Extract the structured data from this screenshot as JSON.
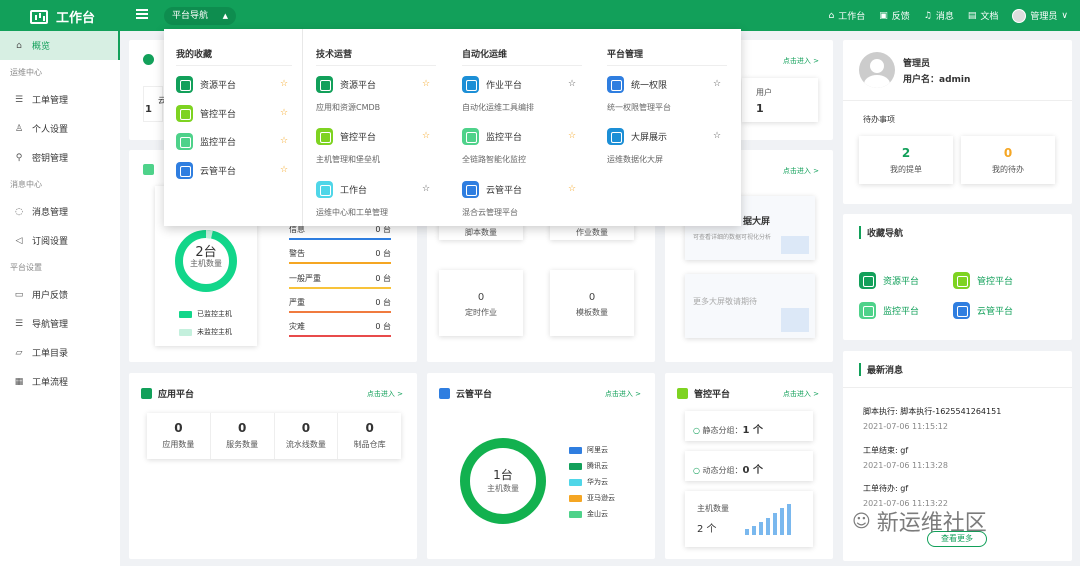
{
  "header": {
    "app_title": "工作台",
    "nav_pill": "平台导航",
    "links": [
      "工作台",
      "反馈",
      "消息",
      "文档"
    ],
    "user": "管理员"
  },
  "sidebar": {
    "overview": "概览",
    "group1": "运维中心",
    "group1_items": [
      "工单管理",
      "个人设置",
      "密钥管理"
    ],
    "group2": "消息中心",
    "group2_items": [
      "消息管理",
      "订阅设置"
    ],
    "group3": "平台设置",
    "group3_items": [
      "用户反馈",
      "导航管理",
      "工单目录",
      "工单流程"
    ]
  },
  "dropdown": {
    "col1": {
      "title": "我的收藏",
      "items": [
        "资源平台",
        "管控平台",
        "监控平台",
        "云管平台"
      ]
    },
    "col2": {
      "title": "技术运营",
      "items": [
        {
          "name": "资源平台",
          "desc": "应用和资源CMDB"
        },
        {
          "name": "管控平台",
          "desc": "主机管理和堡垒机"
        },
        {
          "name": "工作台",
          "desc": "运维中心和工单管理"
        }
      ]
    },
    "col3": {
      "title": "自动化运维",
      "items": [
        {
          "name": "作业平台",
          "desc": "自动化运维工具编排"
        },
        {
          "name": "监控平台",
          "desc": "全链路智能化监控"
        },
        {
          "name": "云管平台",
          "desc": "混合云管理平台"
        }
      ]
    },
    "col4": {
      "title": "平台管理",
      "items": [
        {
          "name": "统一权限",
          "desc": "统一权限管理平台"
        },
        {
          "name": "大屏展示",
          "desc": "运维数据化大屏"
        }
      ]
    }
  },
  "cards": {
    "enter_link": "点击进入 >",
    "resource_partial_value": "1",
    "resource_partial_label": "云",
    "user_label": "用户",
    "user_value": "1",
    "host": {
      "donut_value": "2台",
      "donut_label": "主机数量",
      "legend": [
        "已监控主机",
        "未监控主机"
      ],
      "severity_partial": "信息",
      "severity": [
        {
          "name": "警告",
          "count": "0 台",
          "color": "#f5a623"
        },
        {
          "name": "一般严重",
          "count": "0 台",
          "color": "#f8c33a"
        },
        {
          "name": "严重",
          "count": "0 台",
          "color": "#f07b3f"
        },
        {
          "name": "灾难",
          "count": "0 台",
          "color": "#e84b4b"
        }
      ],
      "severity_partial_count": "0 台"
    },
    "job": {
      "partial1": "脚本数量",
      "partial2": "作业数量",
      "tiles": [
        {
          "num": "0",
          "label": "定时作业"
        },
        {
          "num": "0",
          "label": "模板数量"
        }
      ]
    },
    "screen": {
      "title_partial": "据大屏",
      "desc": "可查看详细的数据可视化分析",
      "more": "更多大屏敬请期待"
    },
    "app": {
      "title": "应用平台",
      "stats": [
        {
          "num": "0",
          "label": "应用数量"
        },
        {
          "num": "0",
          "label": "服务数量"
        },
        {
          "num": "0",
          "label": "流水线数量"
        },
        {
          "num": "0",
          "label": "制品仓库"
        }
      ]
    },
    "cloud": {
      "title": "云管平台",
      "donut_value": "1台",
      "donut_label": "主机数量",
      "legend": [
        {
          "name": "阿里云",
          "color": "#2f7ee0"
        },
        {
          "name": "腾讯云",
          "color": "#12a05a"
        },
        {
          "name": "华为云",
          "color": "#4fd6e8"
        },
        {
          "name": "亚马逊云",
          "color": "#f5a623"
        },
        {
          "name": "金山云",
          "color": "#4ed28a"
        }
      ]
    },
    "control": {
      "title": "管控平台",
      "static_label": "静态分组：",
      "static_value": "1 个",
      "dynamic_label": "动态分组：",
      "dynamic_value": "0 个",
      "host_label": "主机数量",
      "host_value": "2 个"
    }
  },
  "profile": {
    "name": "管理员",
    "username": "用户名：admin",
    "todo_title": "待办事项",
    "todo": [
      {
        "num": "2",
        "label": "我的提单"
      },
      {
        "num": "0",
        "label": "我的待办"
      }
    ]
  },
  "favorites": {
    "title": "收藏导航",
    "items": [
      "资源平台",
      "管控平台",
      "监控平台",
      "云管平台"
    ]
  },
  "news": {
    "title": "最新消息",
    "items": [
      {
        "title": "脚本执行: 脚本执行-1625541264151",
        "date": "2021-07-06 11:15:12"
      },
      {
        "title": "工单结束: gf",
        "date": "2021-07-06 11:13:28"
      },
      {
        "title": "工单待办: gf",
        "date": "2021-07-06 11:13:22"
      }
    ],
    "more": "查看更多"
  },
  "watermark": "新运维社区"
}
